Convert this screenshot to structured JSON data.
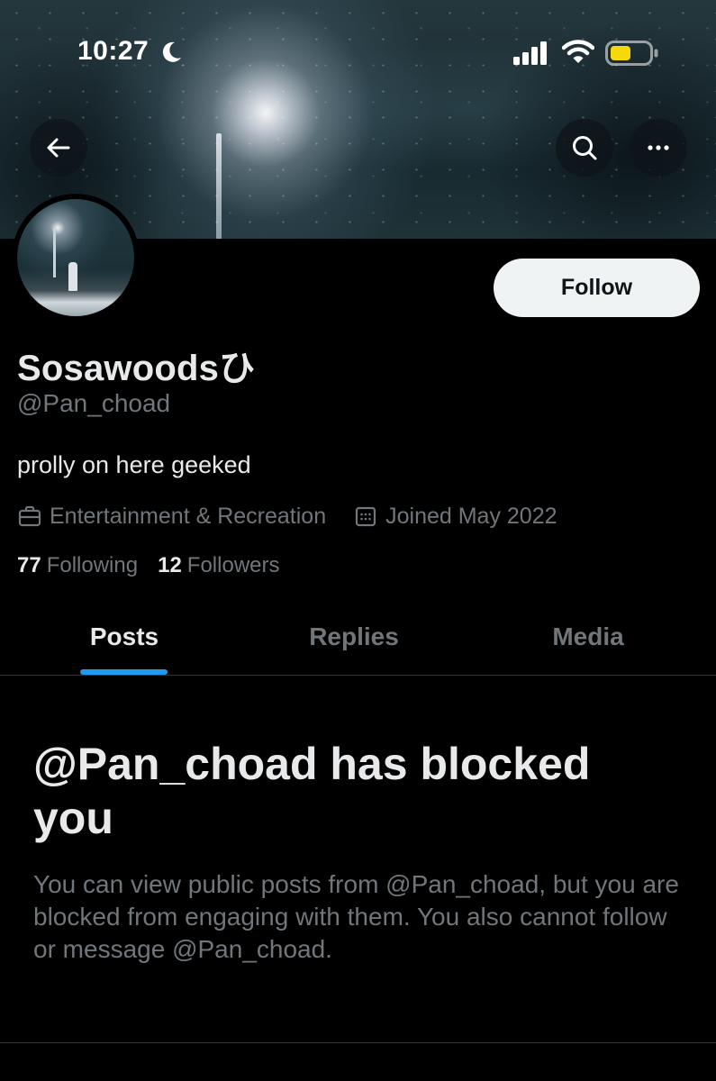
{
  "status_bar": {
    "time": "10:27",
    "moon_icon": "moon-icon",
    "signal_icon": "cellular-signal-icon",
    "wifi_icon": "wifi-icon",
    "battery_icon": "battery-icon",
    "battery_color": "#f5d90a"
  },
  "header": {
    "back_icon": "arrow-left-icon",
    "search_icon": "search-icon",
    "more_icon": "more-horizontal-icon"
  },
  "profile": {
    "display_name": "Sosawoodsひ",
    "handle": "@Pan_choad",
    "bio": "prolly on here geeked",
    "category": "Entertainment & Recreation",
    "category_icon": "briefcase-icon",
    "joined": "Joined May 2022",
    "joined_icon": "calendar-icon",
    "following_count": "77",
    "following_label": "Following",
    "followers_count": "12",
    "followers_label": "Followers",
    "follow_button": "Follow"
  },
  "tabs": [
    {
      "label": "Posts",
      "active": true
    },
    {
      "label": "Replies",
      "active": false
    },
    {
      "label": "Media",
      "active": false
    }
  ],
  "blocked": {
    "title": "@Pan_choad has blocked you",
    "description": "You can view public posts from @Pan_choad, but you are blocked from engaging with them. You also cannot follow or message @Pan_choad."
  },
  "colors": {
    "background": "#000000",
    "primary_text": "#e7e9ea",
    "secondary_text": "#71767b",
    "accent": "#1d9bf0",
    "follow_button_bg": "#eff3f4",
    "divider": "#2f3336"
  }
}
